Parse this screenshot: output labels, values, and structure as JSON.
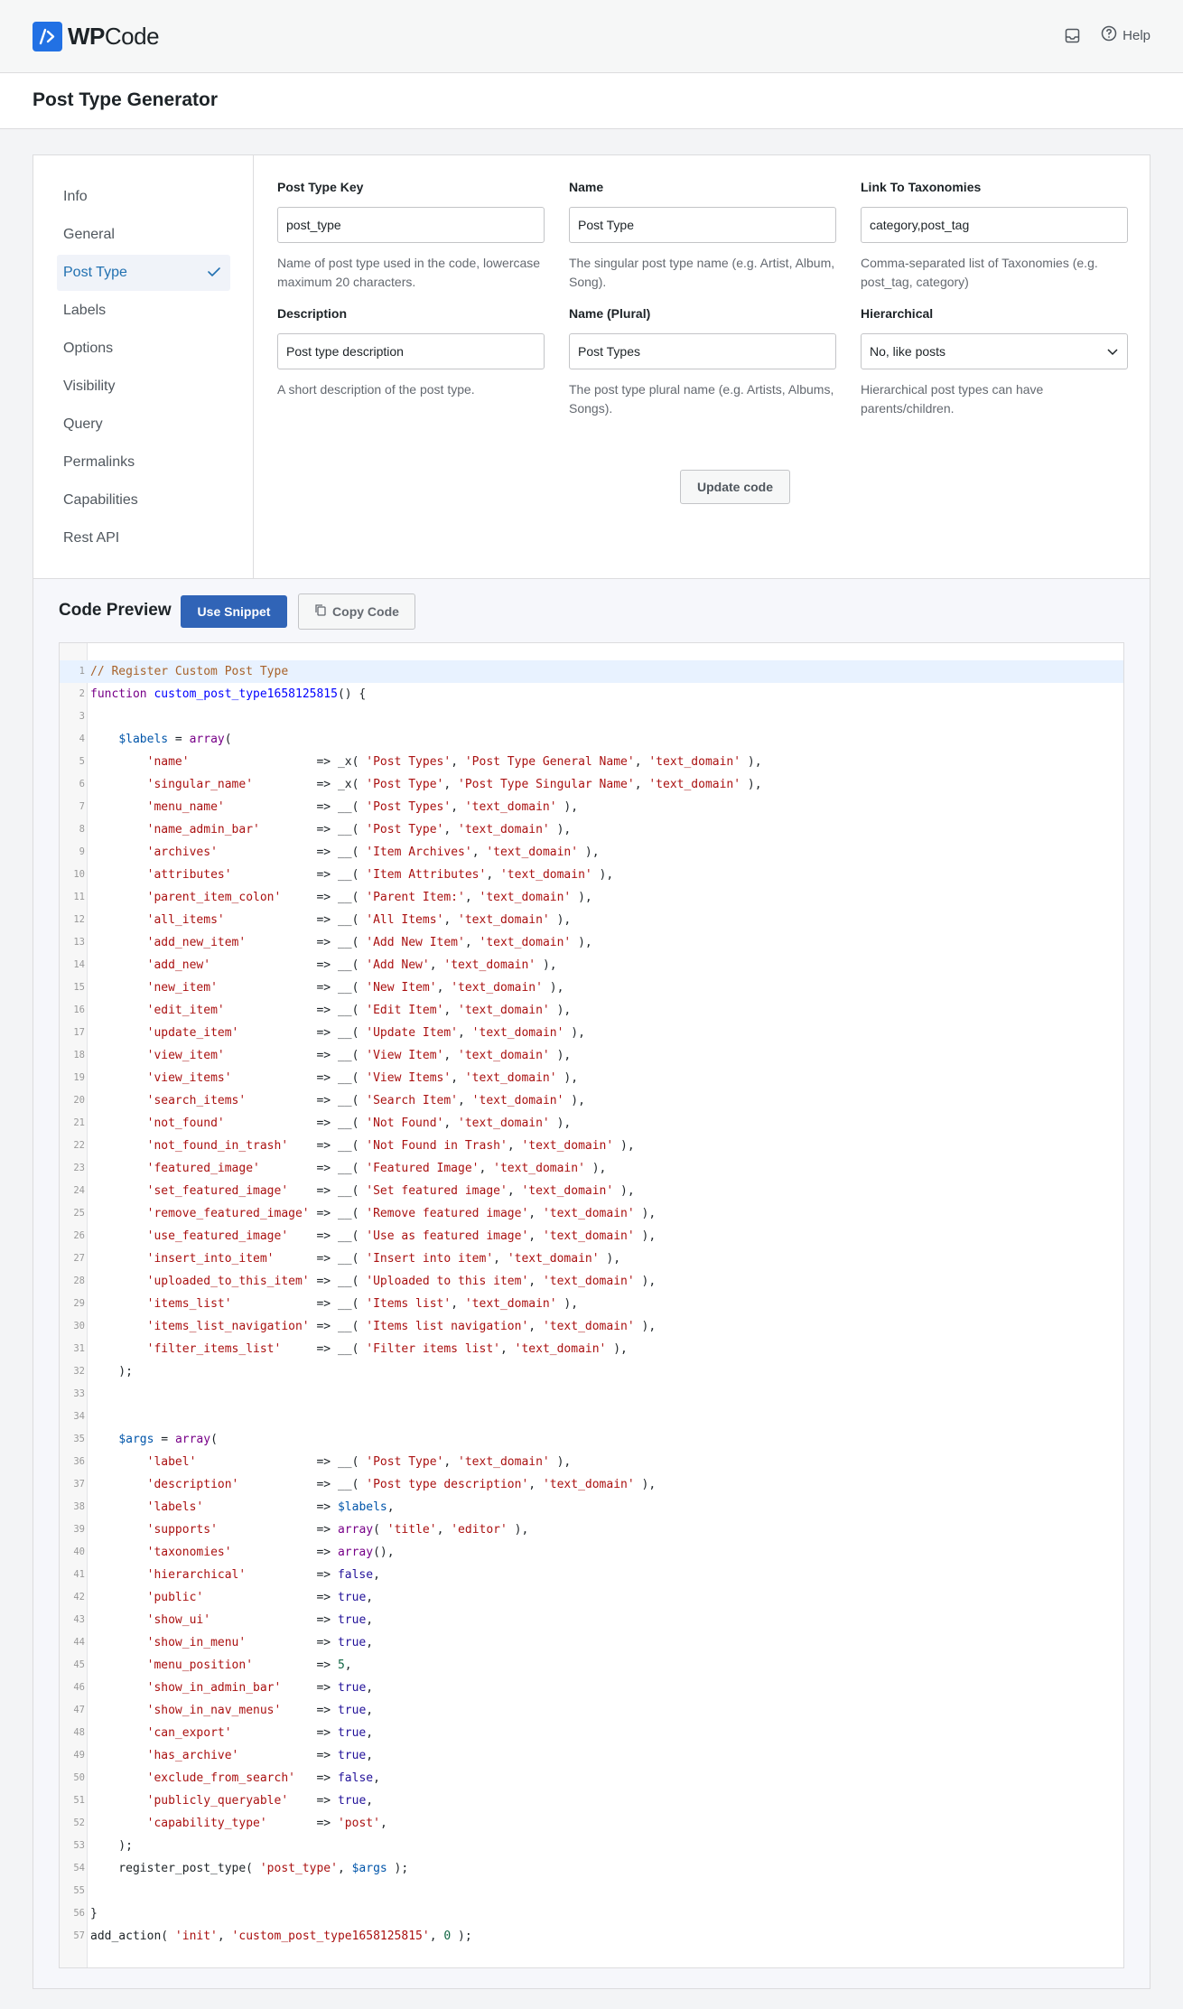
{
  "brand": {
    "logo_bold": "WP",
    "logo_rest": "Code"
  },
  "header": {
    "help_label": "Help"
  },
  "page": {
    "title": "Post Type Generator"
  },
  "nav": {
    "items": [
      "Info",
      "General",
      "Post Type",
      "Labels",
      "Options",
      "Visibility",
      "Query",
      "Permalinks",
      "Capabilities",
      "Rest API"
    ],
    "active": "Post Type"
  },
  "form": {
    "post_type_key": {
      "label": "Post Type Key",
      "value": "post_type",
      "help": "Name of post type used in the code, lowercase maximum 20 characters."
    },
    "name": {
      "label": "Name",
      "value": "Post Type",
      "help": "The singular post type name (e.g. Artist, Album, Song)."
    },
    "link_taxonomies": {
      "label": "Link To Taxonomies",
      "value": "category,post_tag",
      "help": "Comma-separated list of Taxonomies (e.g. post_tag, category)"
    },
    "description": {
      "label": "Description",
      "value": "Post type description",
      "help": "A short description of the post type."
    },
    "name_plural": {
      "label": "Name (Plural)",
      "value": "Post Types",
      "help": "The post type plural name (e.g. Artists, Albums, Songs)."
    },
    "hierarchical": {
      "label": "Hierarchical",
      "value": "No, like posts",
      "help": "Hierarchical post types can have parents/children."
    },
    "update_label": "Update code"
  },
  "preview": {
    "title": "Code Preview",
    "use_snippet_label": "Use Snippet",
    "copy_code_label": "Copy Code",
    "code_lines": [
      "// Register Custom Post Type",
      "function custom_post_type1658125815() {",
      "",
      "    $labels = array(",
      "        'name'                  => _x( 'Post Types', 'Post Type General Name', 'text_domain' ),",
      "        'singular_name'         => _x( 'Post Type', 'Post Type Singular Name', 'text_domain' ),",
      "        'menu_name'             => __( 'Post Types', 'text_domain' ),",
      "        'name_admin_bar'        => __( 'Post Type', 'text_domain' ),",
      "        'archives'              => __( 'Item Archives', 'text_domain' ),",
      "        'attributes'            => __( 'Item Attributes', 'text_domain' ),",
      "        'parent_item_colon'     => __( 'Parent Item:', 'text_domain' ),",
      "        'all_items'             => __( 'All Items', 'text_domain' ),",
      "        'add_new_item'          => __( 'Add New Item', 'text_domain' ),",
      "        'add_new'               => __( 'Add New', 'text_domain' ),",
      "        'new_item'              => __( 'New Item', 'text_domain' ),",
      "        'edit_item'             => __( 'Edit Item', 'text_domain' ),",
      "        'update_item'           => __( 'Update Item', 'text_domain' ),",
      "        'view_item'             => __( 'View Item', 'text_domain' ),",
      "        'view_items'            => __( 'View Items', 'text_domain' ),",
      "        'search_items'          => __( 'Search Item', 'text_domain' ),",
      "        'not_found'             => __( 'Not Found', 'text_domain' ),",
      "        'not_found_in_trash'    => __( 'Not Found in Trash', 'text_domain' ),",
      "        'featured_image'        => __( 'Featured Image', 'text_domain' ),",
      "        'set_featured_image'    => __( 'Set featured image', 'text_domain' ),",
      "        'remove_featured_image' => __( 'Remove featured image', 'text_domain' ),",
      "        'use_featured_image'    => __( 'Use as featured image', 'text_domain' ),",
      "        'insert_into_item'      => __( 'Insert into item', 'text_domain' ),",
      "        'uploaded_to_this_item' => __( 'Uploaded to this item', 'text_domain' ),",
      "        'items_list'            => __( 'Items list', 'text_domain' ),",
      "        'items_list_navigation' => __( 'Items list navigation', 'text_domain' ),",
      "        'filter_items_list'     => __( 'Filter items list', 'text_domain' ),",
      "    );",
      "",
      "",
      "    $args = array(",
      "        'label'                 => __( 'Post Type', 'text_domain' ),",
      "        'description'           => __( 'Post type description', 'text_domain' ),",
      "        'labels'                => $labels,",
      "        'supports'              => array( 'title', 'editor' ),",
      "        'taxonomies'            => array(),",
      "        'hierarchical'          => false,",
      "        'public'                => true,",
      "        'show_ui'               => true,",
      "        'show_in_menu'          => true,",
      "        'menu_position'         => 5,",
      "        'show_in_admin_bar'     => true,",
      "        'show_in_nav_menus'     => true,",
      "        'can_export'            => true,",
      "        'has_archive'           => true,",
      "        'exclude_from_search'   => false,",
      "        'publicly_queryable'    => true,",
      "        'capability_type'       => 'post',",
      "    );",
      "    register_post_type( 'post_type', $args );",
      "",
      "}",
      "add_action( 'init', 'custom_post_type1658125815', 0 );"
    ]
  }
}
